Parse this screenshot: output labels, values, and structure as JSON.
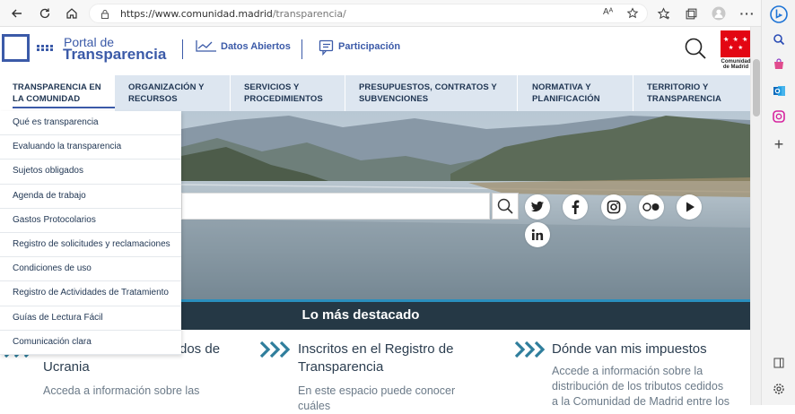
{
  "browser": {
    "url_host": "https://www.comunidad.madrid",
    "url_path": "/transparencia/"
  },
  "header": {
    "portal_line1": "Portal de",
    "portal_line2": "Transparencia",
    "datos_abiertos": "Datos Abiertos",
    "participacion": "Participación",
    "cm_text": "Comunidad\nde Madrid"
  },
  "nav": [
    {
      "label": "TRANSPARENCIA EN\nLA COMUNIDAD"
    },
    {
      "label": "ORGANIZACIÓN Y\nRECURSOS"
    },
    {
      "label": "SERVICIOS Y\nPROCEDIMIENTOS"
    },
    {
      "label": "PRESUPUESTOS, CONTRATOS Y\nSUBVENCIONES"
    },
    {
      "label": "NORMATIVA Y\nPLANIFICACIÓN"
    },
    {
      "label": "TERRITORIO Y\nTRANSPARENCIA"
    }
  ],
  "dropdown": [
    "Qué es transparencia",
    "Evaluando la transparencia",
    "Sujetos obligados",
    "Agenda de trabajo",
    "Gastos Protocolarios",
    "Registro de solicitudes y reclamaciones",
    "Condiciones de uso",
    "Registro de Actividades de Tratamiento",
    "Guías de Lectura Fácil",
    "Comunicación clara"
  ],
  "featured": {
    "title": "Lo más destacado"
  },
  "cards": [
    {
      "title_tail": "dos de",
      "title_line2": "Ucrania",
      "text": "Acceda a información sobre las"
    },
    {
      "title": "Inscritos en el Registro de\nTransparencia",
      "text": "En este espacio puede conocer cuáles"
    },
    {
      "title": "Dónde van mis impuestos",
      "text": "Accede a información sobre la\ndistribución de los tributos cedidos\na la Comunidad de Madrid entre los"
    }
  ],
  "colors": {
    "brand": "#3b5aa8",
    "nav_bg": "#dde6f0",
    "featured_bg": "#253845",
    "accent": "#2a8fbd",
    "chevron": "#2f7e9c"
  },
  "icons": [
    "back-icon",
    "refresh-icon",
    "home-icon",
    "lock-icon",
    "read-aloud-icon",
    "favorite-add-icon",
    "favorites-icon",
    "collections-icon",
    "profile-icon",
    "more-icon",
    "bing-icon",
    "search-icon",
    "twitter-icon",
    "facebook-icon",
    "instagram-icon",
    "flickr-icon",
    "youtube-icon",
    "linkedin-icon"
  ]
}
